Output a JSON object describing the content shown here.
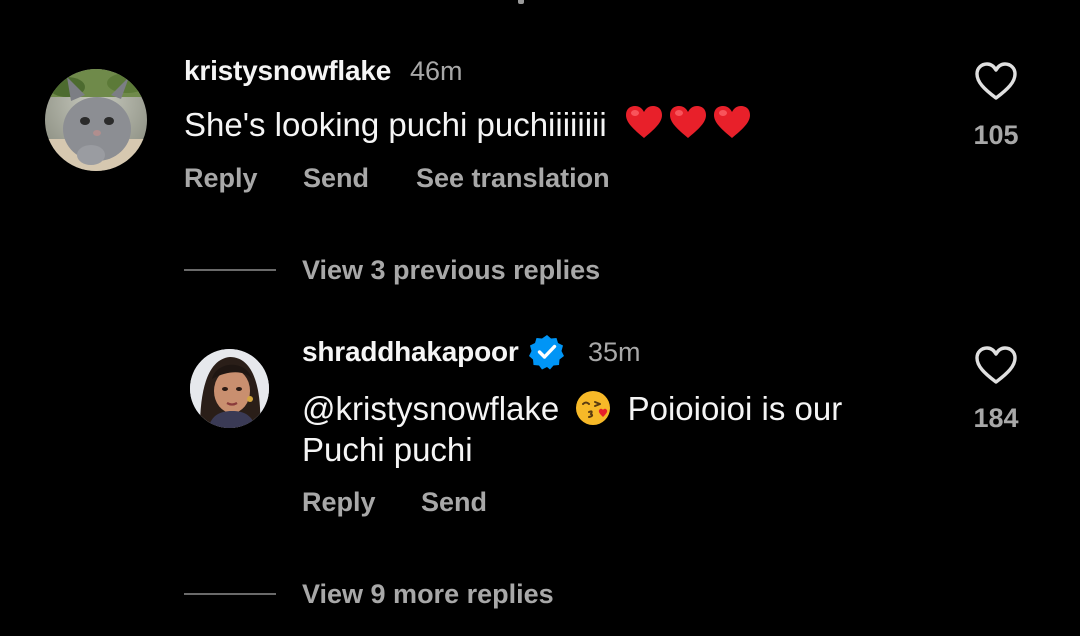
{
  "comments": [
    {
      "username": "kristysnowflake",
      "time": "46m",
      "text": "She's looking puchi puchiiiiiiii",
      "emojis": [
        "red-heart",
        "red-heart",
        "red-heart"
      ],
      "actions": {
        "reply": "Reply",
        "send": "Send",
        "translate": "See translation"
      },
      "likes": "105",
      "avatar": "cat-avatar"
    }
  ],
  "thread": {
    "previous_replies": "View 3 previous replies",
    "more_replies": "View 9 more replies"
  },
  "reply": {
    "username": "shraddhakapoor",
    "verified": true,
    "time": "35m",
    "mention": "@kristysnowflake",
    "emoji": "face-blowing-a-kiss",
    "text_after_emoji": "Poioioioi is our",
    "text_line2": "Puchi puchi",
    "actions": {
      "reply": "Reply",
      "send": "Send"
    },
    "likes": "184",
    "avatar": "woman-avatar"
  },
  "colors": {
    "background": "#000000",
    "primary_text": "#f5f5f5",
    "secondary_text": "#a8a8a8",
    "verified_blue": "#0095f6",
    "heart_red": "#e8202a"
  }
}
